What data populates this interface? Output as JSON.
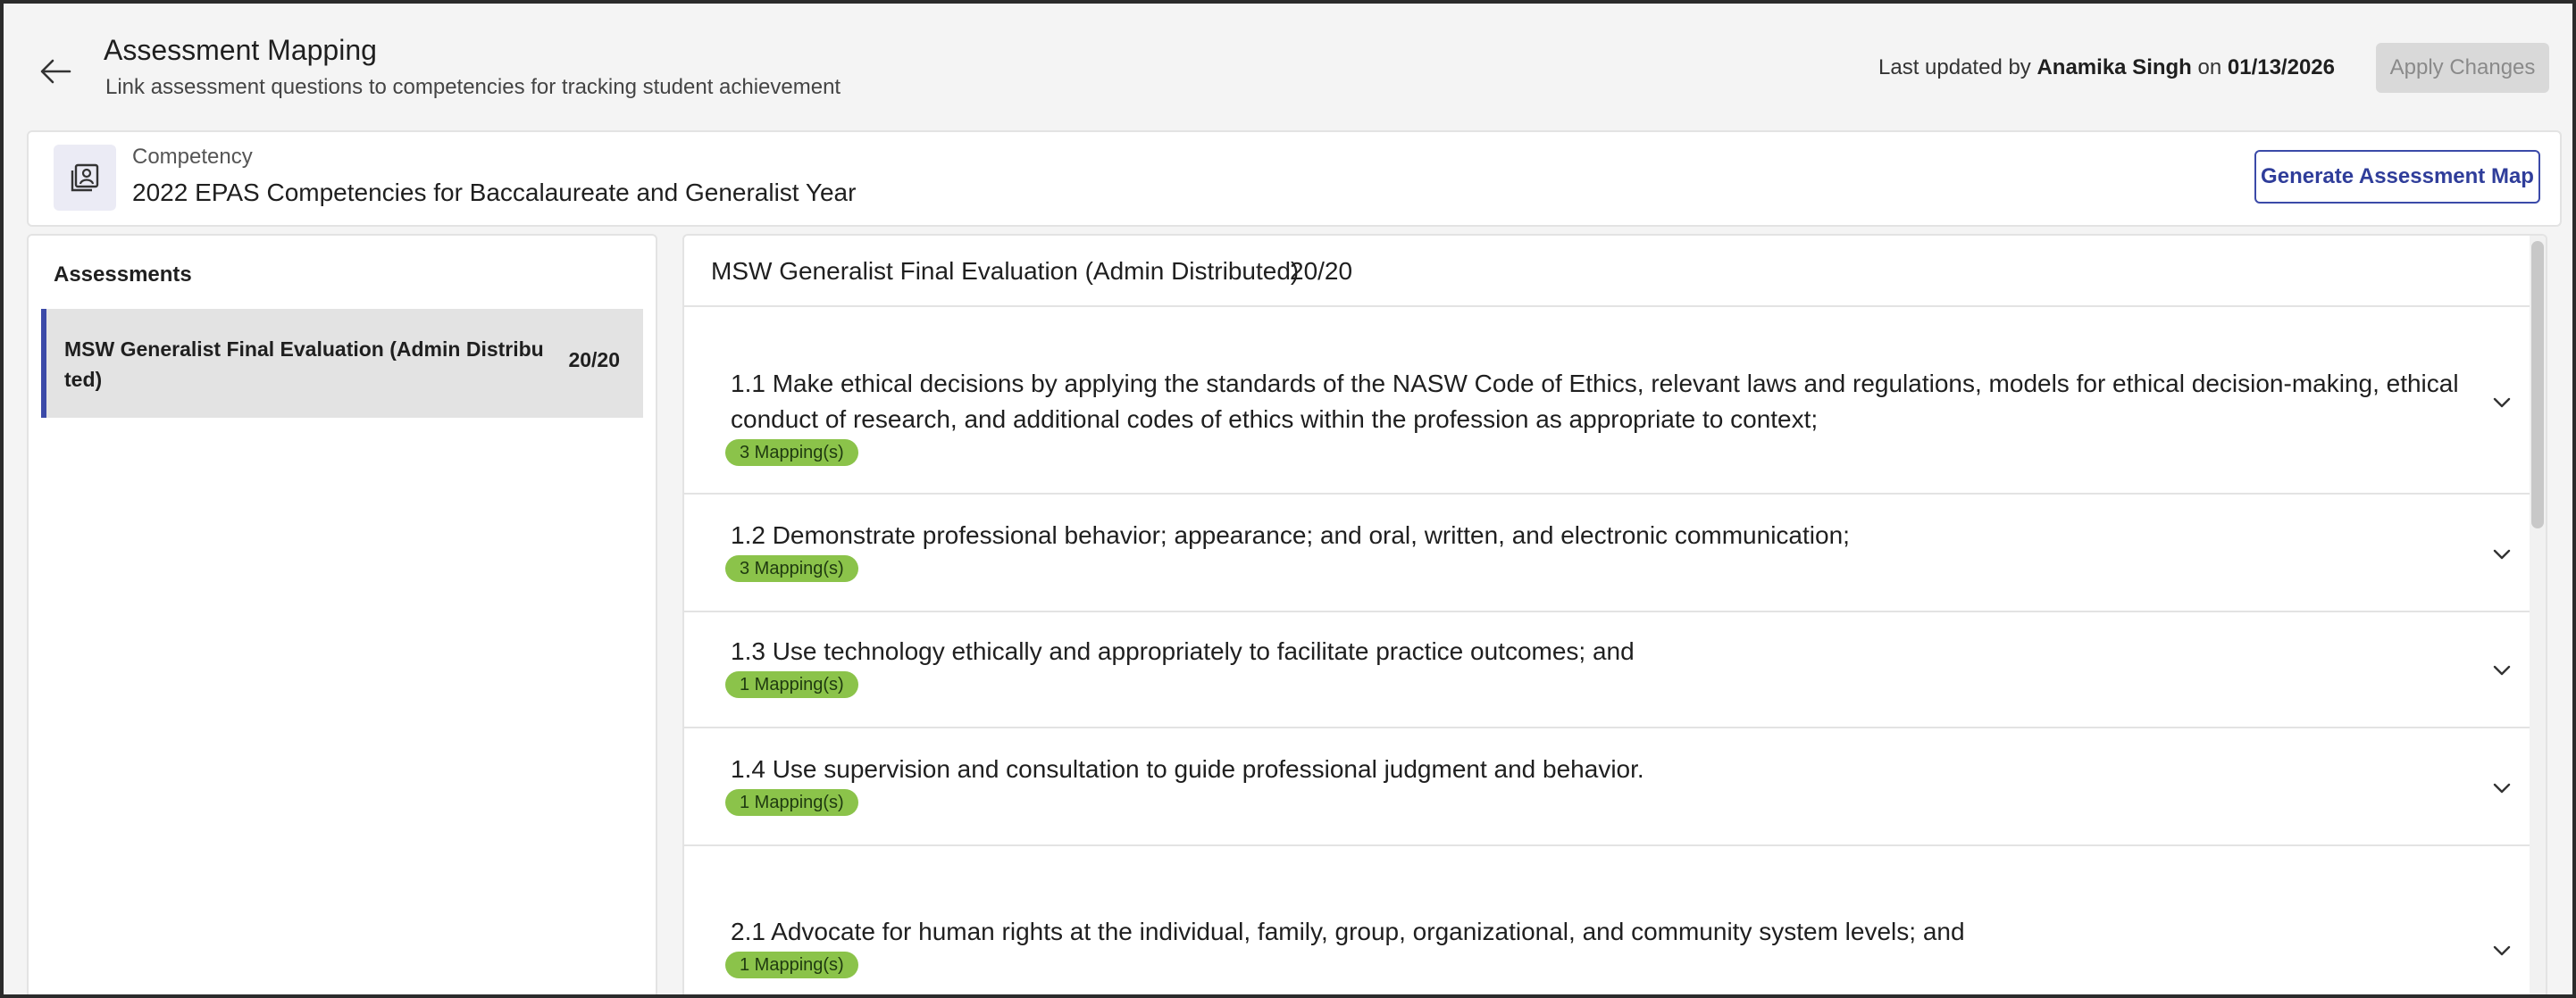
{
  "header": {
    "title": "Assessment Mapping",
    "subtitle": "Link assessment questions to competencies for tracking student achievement",
    "updated_prefix": "Last updated by ",
    "updated_by": "Anamika Singh",
    "updated_mid": " on ",
    "updated_date": "01/13/2026",
    "apply_label": "Apply Changes",
    "back_icon": "arrow-left-icon"
  },
  "competency": {
    "label": "Competency",
    "value": "2022 EPAS Competencies for Baccalaureate and Generalist Year",
    "icon": "competency-icon",
    "generate_label": "Generate Assessment Map"
  },
  "assessments": {
    "title": "Assessments",
    "items": [
      {
        "name": "MSW Generalist Final Evaluation (Admin Distributed)",
        "score": "20/20",
        "selected": true
      }
    ]
  },
  "detail": {
    "title": "MSW Generalist Final Evaluation (Admin Distributed)",
    "score": "20/20",
    "questions": [
      {
        "text": "1.1 Make ethical decisions by applying the standards of the NASW Code of Ethics, relevant laws and regulations, models for ethical decision-making, ethical conduct of research, and additional codes of ethics within the profession as appropriate to context;",
        "badge": "3 Mapping(s)"
      },
      {
        "text": "1.2 Demonstrate professional behavior; appearance; and oral, written, and electronic communication;",
        "badge": "3 Mapping(s)"
      },
      {
        "text": "1.3 Use technology ethically and appropriately to facilitate practice outcomes; and",
        "badge": "1 Mapping(s)"
      },
      {
        "text": "1.4 Use supervision and consultation to guide professional judgment and behavior.",
        "badge": "1 Mapping(s)"
      },
      {
        "text": "2.1 Advocate for human rights at the individual, family, group, organizational, and community system levels; and",
        "badge": "1 Mapping(s)"
      }
    ]
  },
  "colors": {
    "accent": "#3b4aa8",
    "badge_bg": "#8bc34a",
    "selected_bg": "#e3e3e3"
  }
}
